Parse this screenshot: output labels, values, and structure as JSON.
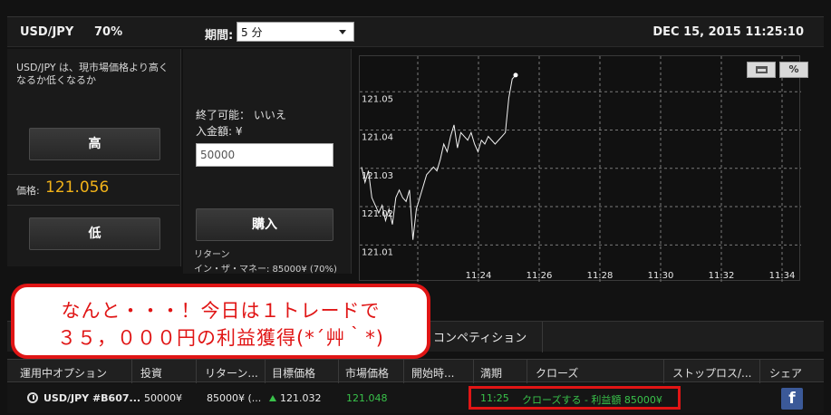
{
  "header": {
    "pair": "USD/JPY",
    "percent": "70%",
    "period_label": "期間:",
    "period_value": "5 分",
    "datetime": "DEC 15, 2015 11:25:10"
  },
  "left": {
    "description": "USD/JPY は、現市場価格より高くなるか低くなるか",
    "high_label": "高",
    "price_label": "価格:",
    "price_value": "121.056",
    "low_label": "低"
  },
  "order": {
    "can_close": "終了可能： いいえ",
    "amount_label": "入金額: ¥",
    "amount_value": "50000",
    "buy_label": "購入",
    "return_label": "リターン",
    "in_the_money": "イン・ザ・マネー: 85000¥ (70%)"
  },
  "chart_data": {
    "type": "line",
    "y_ticks": [
      "121.05",
      "121.04",
      "121.03",
      "121.02",
      "121.01"
    ],
    "x_ticks": [
      "11:24",
      "11:26",
      "11:28",
      "11:30",
      "11:32",
      "11:34"
    ],
    "ylim": [
      121.007,
      121.06
    ],
    "grid": true,
    "points": [
      [
        0,
        121.032
      ],
      [
        1,
        121.028
      ],
      [
        2,
        121.031
      ],
      [
        3,
        121.024
      ],
      [
        4,
        121.022
      ],
      [
        5,
        121.02
      ],
      [
        6,
        121.022
      ],
      [
        7,
        121.018
      ],
      [
        8,
        121.021
      ],
      [
        9,
        121.017
      ],
      [
        10,
        121.024
      ],
      [
        11,
        121.026
      ],
      [
        12,
        121.024
      ],
      [
        13,
        121.023
      ],
      [
        14,
        121.026
      ],
      [
        15,
        121.013
      ],
      [
        16,
        121.021
      ],
      [
        17,
        121.024
      ],
      [
        18,
        121.027
      ],
      [
        19,
        121.03
      ],
      [
        20,
        121.031
      ],
      [
        21,
        121.032
      ],
      [
        22,
        121.031
      ],
      [
        23,
        121.034
      ],
      [
        24,
        121.038
      ],
      [
        25,
        121.036
      ],
      [
        26,
        121.04
      ],
      [
        27,
        121.043
      ],
      [
        28,
        121.037
      ],
      [
        29,
        121.041
      ],
      [
        30,
        121.04
      ],
      [
        31,
        121.039
      ],
      [
        32,
        121.041
      ],
      [
        33,
        121.038
      ],
      [
        34,
        121.036
      ],
      [
        35,
        121.039
      ],
      [
        36,
        121.038
      ],
      [
        37,
        121.04
      ],
      [
        38,
        121.039
      ],
      [
        39,
        121.038
      ],
      [
        40,
        121.039
      ],
      [
        41,
        121.04
      ],
      [
        42,
        121.041
      ],
      [
        43,
        121.05
      ],
      [
        44,
        121.055
      ],
      [
        45,
        121.056
      ]
    ],
    "toolbar": [
      "chart-view-icon",
      "percent-view-icon"
    ]
  },
  "callout": {
    "line1": "なんと・・・！今日は１トレードで",
    "line2": "３５，０００円の利益獲得(*´艸｀*)"
  },
  "tabs": {
    "competition": "コンペティション"
  },
  "table": {
    "headers": [
      "運用中オプション",
      "投資",
      "リターン...",
      "目標価格",
      "市場価格",
      "開始時...",
      "満期",
      "クローズ",
      "ストップロス/...",
      "シェア"
    ],
    "row": {
      "option": "USD/JPY #B607...",
      "investment": "50000¥",
      "return": "85000¥ (...",
      "target": "121.032",
      "market": "121.048",
      "expiry": "11:25",
      "close_text": "クローズする - 利益額 85000¥"
    }
  },
  "colors": {
    "price": "#f2b319",
    "profit_green": "#39c24a",
    "callout_red": "#e01515",
    "facebook": "#3b5998"
  }
}
